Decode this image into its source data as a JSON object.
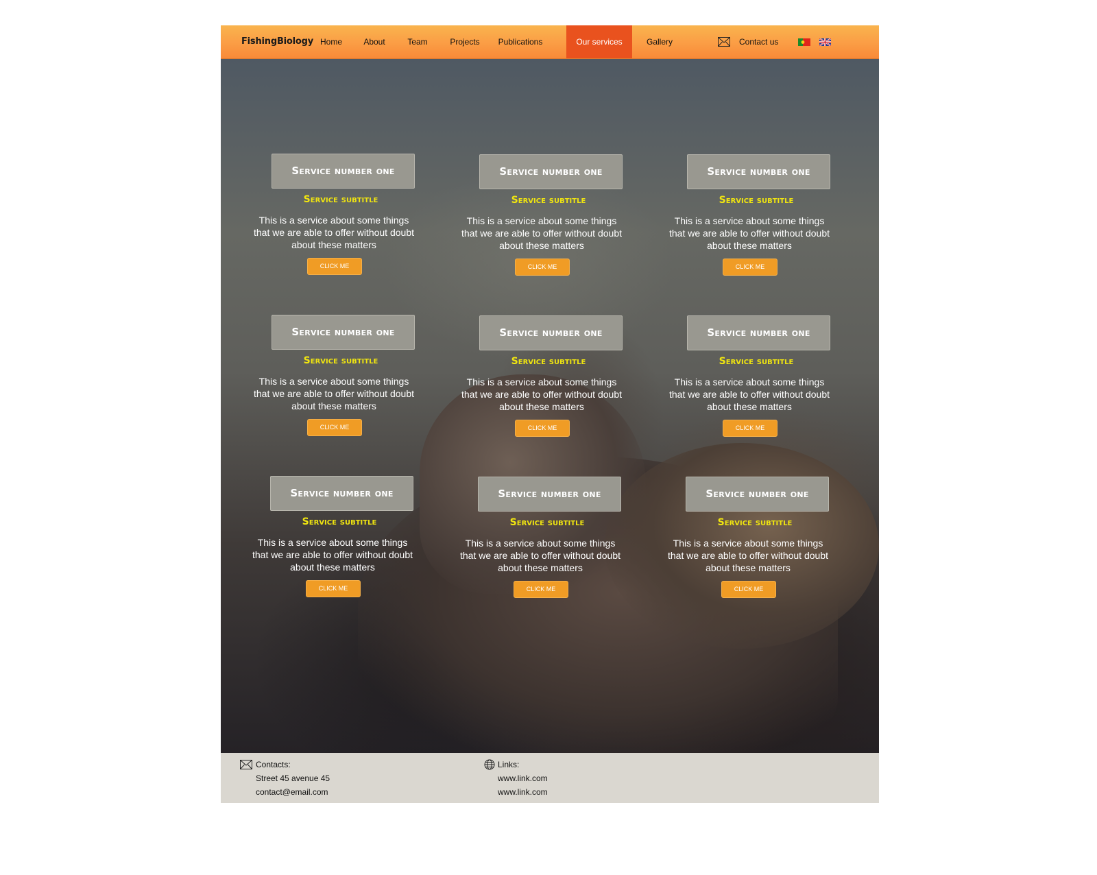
{
  "header": {
    "brand": "FishingBiology",
    "nav": [
      {
        "label": "Home"
      },
      {
        "label": "About"
      },
      {
        "label": "Team"
      },
      {
        "label": "Projects"
      },
      {
        "label": "Publications"
      },
      {
        "label": "Our services",
        "active": true
      },
      {
        "label": "Gallery"
      }
    ],
    "contact_label": "Contact us",
    "languages": [
      "portugal-flag-icon",
      "uk-flag-icon"
    ]
  },
  "services": [
    {
      "title": "Service number one",
      "subtitle": "Service subtitle",
      "description": "This is a service about some things that we are able to offer without doubt about these matters",
      "button": "CLICK ME"
    },
    {
      "title": "Service number one",
      "subtitle": "Service subtitle",
      "description": "This is a service about some things that we are able to offer without doubt about these matters",
      "button": "CLICK ME"
    },
    {
      "title": "Service number one",
      "subtitle": "Service subtitle",
      "description": "This is a service about some things that we are able to offer without doubt about these matters",
      "button": "CLICK ME"
    },
    {
      "title": "Service number one",
      "subtitle": "Service subtitle",
      "description": "This is a service about some things that we are able to offer without doubt about these matters",
      "button": "CLICK ME"
    },
    {
      "title": "Service number one",
      "subtitle": "Service subtitle",
      "description": "This is a service about some things that we are able to offer without doubt about these matters",
      "button": "CLICK ME"
    },
    {
      "title": "Service number one",
      "subtitle": "Service subtitle",
      "description": "This is a service about some things that we are able to offer without doubt about these matters",
      "button": "CLICK ME"
    },
    {
      "title": "Service number one",
      "subtitle": "Service subtitle",
      "description": "This is a service about some things that we are able to offer without doubt about these matters",
      "button": "CLICK ME"
    },
    {
      "title": "Service number one",
      "subtitle": "Service subtitle",
      "description": "This is a service about some things that we are able to offer without doubt about these matters",
      "button": "CLICK ME"
    },
    {
      "title": "Service number one",
      "subtitle": "Service subtitle",
      "description": "This is a service about some things that we are able to offer without doubt about these matters",
      "button": "CLICK ME"
    }
  ],
  "footer": {
    "contacts_label": "Contacts:",
    "address": "Street 45 avenue 45",
    "email": "contact@email.com",
    "links_label": "Links:",
    "links": [
      "www.link.com",
      "www.link.com"
    ]
  },
  "colors": {
    "nav_gradient_top": "#f9b44e",
    "nav_gradient_bottom": "#f98a38",
    "nav_active": "#e9521e",
    "card_title_bg": "#999890",
    "subtitle": "#f0e510",
    "button": "#f09c25",
    "footer_bg": "#dad7d0"
  }
}
